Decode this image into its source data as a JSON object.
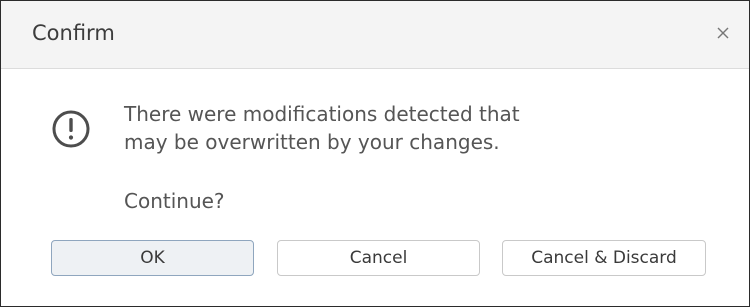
{
  "dialog": {
    "title": "Confirm",
    "close_icon": "close-icon",
    "warning_icon": "exclamation-circle-icon",
    "message_line1": "There were modifications detected that",
    "message_line2": "may be overwritten by your changes.",
    "question": "Continue?",
    "buttons": {
      "ok": "OK",
      "cancel": "Cancel",
      "cancel_discard": "Cancel & Discard"
    }
  },
  "colors": {
    "titlebar_bg": "#f4f4f4",
    "primary_button_border": "#8fa6be",
    "text": "#555555"
  }
}
